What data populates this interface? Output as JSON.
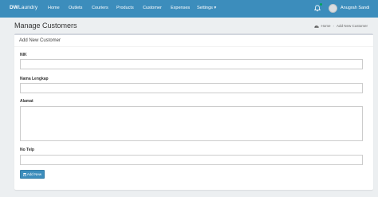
{
  "navbar": {
    "brand_prefix": "DW",
    "brand_suffix": "Laundry",
    "items": [
      {
        "label": "Home"
      },
      {
        "label": "Outlets"
      },
      {
        "label": "Couriers"
      },
      {
        "label": "Products"
      },
      {
        "label": "Customer"
      },
      {
        "label": "Expenses"
      },
      {
        "label": "Settings ▾"
      }
    ],
    "user_name": "Anugrah Sandi",
    "accent_color": "#3c8dbc",
    "notification_dot_color": "#00a65a"
  },
  "page": {
    "title": "Manage Customers",
    "breadcrumb": {
      "home": "Home",
      "current": "Add New Customer"
    }
  },
  "form": {
    "box_title": "Add New Customer",
    "fields": {
      "nik": {
        "label": "NIK",
        "value": "",
        "placeholder": ""
      },
      "nama": {
        "label": "Nama Lengkap",
        "value": "",
        "placeholder": ""
      },
      "alamat": {
        "label": "Alamat",
        "value": "",
        "placeholder": ""
      },
      "telp": {
        "label": "No Telp",
        "value": "",
        "placeholder": ""
      }
    },
    "submit_label": "Add New"
  }
}
